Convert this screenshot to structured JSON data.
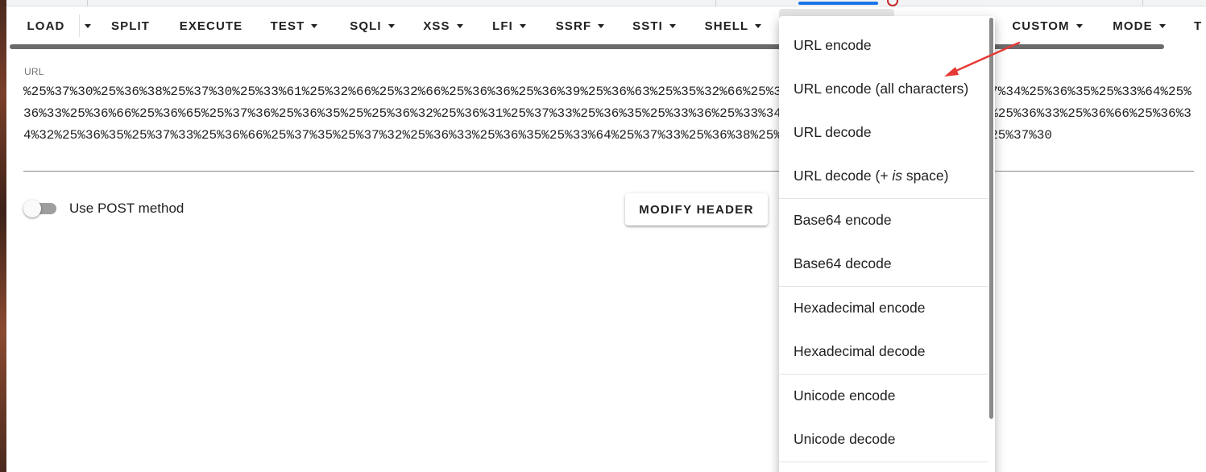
{
  "toolbar": {
    "load": "LOAD",
    "split": "SPLIT",
    "execute": "EXECUTE",
    "test": "TEST",
    "sqli": "SQLI",
    "xss": "XSS",
    "lfi": "LFI",
    "ssrf": "SSRF",
    "ssti": "SSTI",
    "shell": "SHELL",
    "custom": "CUSTOM",
    "mode": "MODE",
    "partial": "T"
  },
  "url": {
    "label": "URL",
    "value": "%25%37%30%25%36%38%25%37%30%25%33%61%25%32%66%25%32%66%25%36%36%25%36%39%25%36%63%25%35%32%66%25%37%37%25%37%32%25%36%39%25%37%34%25%36%35%25%33%64%25%36%33%25%36%66%25%36%65%25%37%36%25%36%35%25%25%36%32%25%36%31%25%37%33%25%36%35%25%33%36%25%33%34%25%32%64%25%36%34%25%36%35%25%36%33%25%36%66%25%36%34%32%25%36%35%25%37%33%25%36%66%25%37%35%25%37%32%25%36%33%25%36%35%25%33%64%25%37%33%25%36%38%25%36%35%25%36%37%30%25%36%38%25%37%30"
  },
  "post_switch": {
    "label": "Use POST method",
    "enabled": false
  },
  "modify_header": "MODIFY HEADER",
  "menu": {
    "items": [
      {
        "label": "URL encode"
      },
      {
        "label": "URL encode (all characters)"
      },
      {
        "label": "URL decode"
      },
      {
        "label_pre": "URL decode (+ ",
        "label_em": "is",
        "label_post": " space)"
      },
      {
        "label": "Base64 encode"
      },
      {
        "label": "Base64 decode"
      },
      {
        "label": "Hexadecimal encode"
      },
      {
        "label": "Hexadecimal decode"
      },
      {
        "label": "Unicode encode"
      },
      {
        "label": "Unicode decode"
      }
    ]
  },
  "colors": {
    "accent": "#1a73e8",
    "annotation": "#e53935",
    "toolbar_text": "#212121"
  }
}
